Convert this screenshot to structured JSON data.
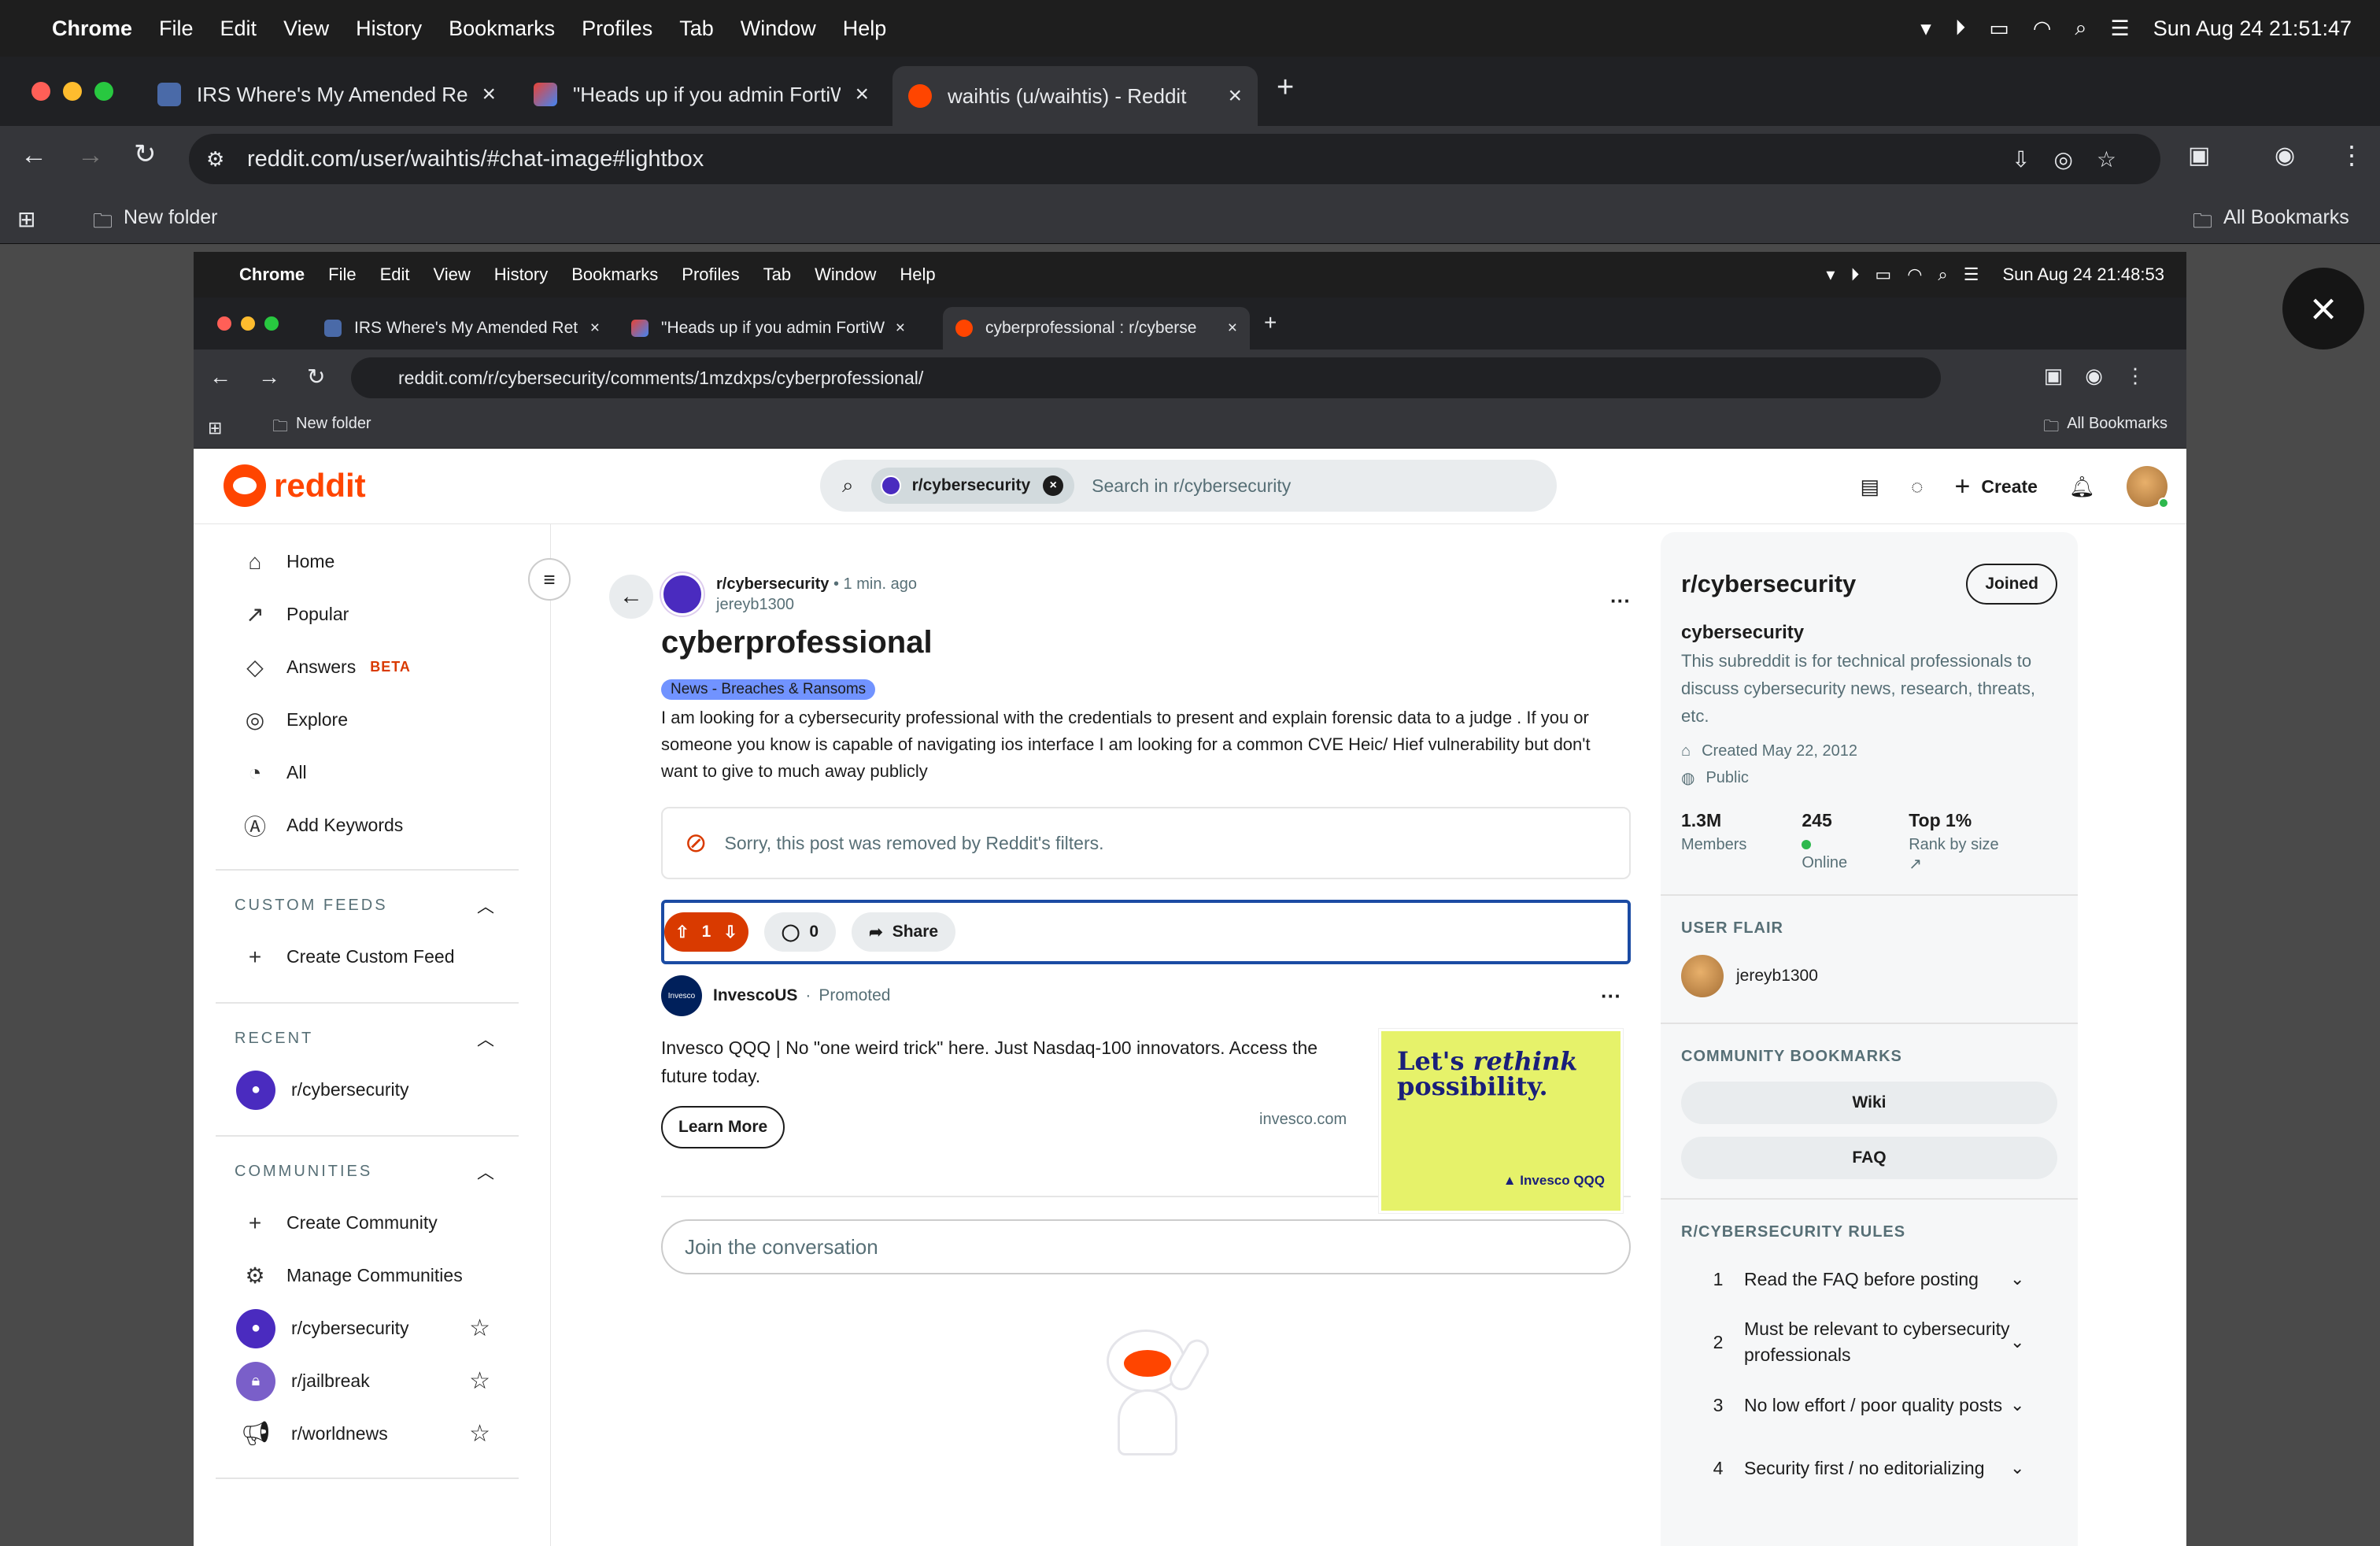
{
  "menubar": {
    "app": "Chrome",
    "items": [
      "File",
      "Edit",
      "View",
      "History",
      "Bookmarks",
      "Profiles",
      "Tab",
      "Window",
      "Help"
    ],
    "datetime": "Sun Aug 24  21:51:47"
  },
  "browser": {
    "tabs": [
      {
        "title": "IRS Where's My Amended Ret"
      },
      {
        "title": "\"Heads up if you admin FortiW"
      },
      {
        "title": "waihtis (u/waihtis) - Reddit"
      }
    ],
    "url": "reddit.com/user/waihtis/#chat-image#lightbox",
    "bookmarks": {
      "folder": "New folder",
      "all": "All Bookmarks"
    }
  },
  "inner": {
    "menubar": {
      "app": "Chrome",
      "items": [
        "File",
        "Edit",
        "View",
        "History",
        "Bookmarks",
        "Profiles",
        "Tab",
        "Window",
        "Help"
      ],
      "datetime": "Sun Aug 24  21:48:53"
    },
    "tabs": [
      {
        "title": "IRS Where's My Amended Ret"
      },
      {
        "title": "\"Heads up if you admin FortiW"
      },
      {
        "title": "cyberprofessional : r/cyberse"
      }
    ],
    "url": "reddit.com/r/cybersecurity/comments/1mzdxps/cyberprofessional/",
    "bookmarks": {
      "folder": "New folder",
      "all": "All Bookmarks"
    }
  },
  "reddit": {
    "logo": "reddit",
    "search": {
      "chip": "r/cybersecurity",
      "placeholder": "Search in r/cybersecurity"
    },
    "create_label": "Create",
    "nav": [
      {
        "label": "Home",
        "icon": "home-icon"
      },
      {
        "label": "Popular",
        "icon": "popular-icon"
      },
      {
        "label": "Answers",
        "icon": "answers-icon",
        "badge": "BETA"
      },
      {
        "label": "Explore",
        "icon": "explore-icon"
      },
      {
        "label": "All",
        "icon": "all-icon"
      },
      {
        "label": "Add Keywords",
        "icon": "keywords-icon"
      }
    ],
    "custom_feeds": {
      "header": "CUSTOM FEEDS",
      "create": "Create Custom Feed"
    },
    "recent": {
      "header": "RECENT",
      "items": [
        "r/cybersecurity"
      ]
    },
    "communities": {
      "header": "COMMUNITIES",
      "create": "Create Community",
      "manage": "Manage Communities",
      "items": [
        "r/cybersecurity",
        "r/jailbreak",
        "r/worldnews"
      ]
    },
    "post": {
      "subreddit": "r/cybersecurity",
      "time": "1 min. ago",
      "author": "jereyb1300",
      "title": "cyberprofessional",
      "flair": "News - Breaches & Ransoms",
      "body": "I am looking for a cybersecurity professional with the credentials to present and explain forensic data to a judge . If you or someone you know is capable of navigating ios interface I am looking for a common CVE Heic/ Hief vulnerability but don't want to give to much away publicly",
      "removed_notice": "Sorry, this post was removed by Reddit's filters.",
      "votes": "1",
      "comments": "0",
      "share": "Share"
    },
    "ad": {
      "advertiser": "InvescoUS",
      "logo_text": "Invesco",
      "promoted": "Promoted",
      "text": "Invesco QQQ | No \"one weird trick\" here. Just Nasdaq-100 innovators. Access the future today.",
      "cta": "Learn More",
      "domain": "invesco.com",
      "image_text_1": "Let's ",
      "image_text_em": "rethink",
      "image_text_2": "possibility.",
      "image_brand": "Invesco QQQ"
    },
    "join_placeholder": "Join the conversation",
    "community": {
      "title": "r/cybersecurity",
      "joined": "Joined",
      "name": "cybersecurity",
      "description": "This subreddit is for technical professionals to discuss cybersecurity news, research, threats, etc.",
      "created": "Created May 22, 2012",
      "visibility": "Public",
      "members_value": "1.3M",
      "members_label": "Members",
      "online_value": "245",
      "online_label": "Online",
      "rank_value": "Top 1%",
      "rank_label": "Rank by size",
      "user_flair_header": "USER FLAIR",
      "user_flair_name": "jereyb1300",
      "bookmarks_header": "COMMUNITY BOOKMARKS",
      "bookmarks": [
        "Wiki",
        "FAQ"
      ],
      "rules_header": "R/CYBERSECURITY RULES",
      "rules": [
        {
          "n": "1",
          "t": "Read the FAQ before posting"
        },
        {
          "n": "2",
          "t": "Must be relevant to cybersecurity professionals"
        },
        {
          "n": "3",
          "t": "No low effort / poor quality posts"
        },
        {
          "n": "4",
          "t": "Security first / no editorializing"
        }
      ]
    }
  },
  "colors": {
    "reddit_orange": "#ff4500",
    "upvote": "#d93a00",
    "focus_ring": "#1b4ba3"
  }
}
